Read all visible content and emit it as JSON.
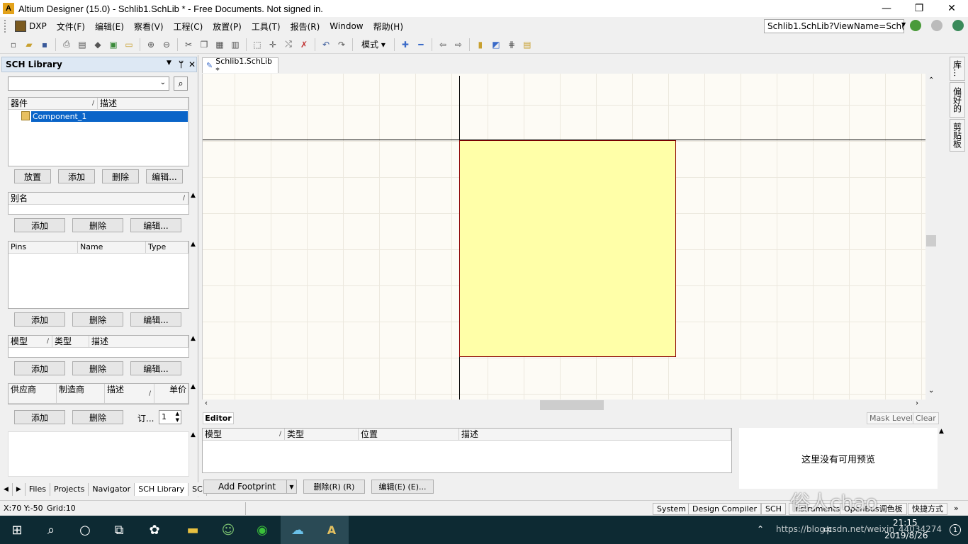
{
  "window": {
    "title": "Altium Designer (15.0) - Schlib1.SchLib * - Free Documents. Not signed in.",
    "controls": {
      "minimize": "—",
      "maximize": "❐",
      "close": "✕"
    }
  },
  "menubar": {
    "items": [
      "DXP",
      "文件(F)",
      "编辑(E)",
      "察看(V)",
      "工程(C)",
      "放置(P)",
      "工具(T)",
      "报告(R)",
      "Window",
      "帮助(H)"
    ],
    "address": "Schlib1.SchLib?ViewName=Sch("
  },
  "toolbar": {
    "mode_label": "模式"
  },
  "sch_library": {
    "title": "SCH Library",
    "components": {
      "columns": [
        "器件",
        "描述"
      ],
      "rows": [
        {
          "name": "Component_1",
          "selected": true
        }
      ],
      "buttons": [
        "放置",
        "添加",
        "删除",
        "编辑..."
      ]
    },
    "aliases": {
      "columns": [
        "别名"
      ],
      "buttons": [
        "添加",
        "删除",
        "编辑..."
      ]
    },
    "pins": {
      "columns": [
        "Pins",
        "Name",
        "Type"
      ],
      "buttons": [
        "添加",
        "删除",
        "编辑..."
      ]
    },
    "models": {
      "columns": [
        "模型",
        "类型",
        "描述"
      ],
      "buttons": [
        "添加",
        "删除",
        "编辑..."
      ]
    },
    "suppliers": {
      "columns": [
        "供应商",
        "制造商",
        "描述",
        "单价"
      ],
      "buttons": [
        "添加",
        "删除"
      ],
      "order_label": "订...",
      "order_qty": "1"
    },
    "bottom_tabs": [
      "Files",
      "Projects",
      "Navigator",
      "SCH Library",
      "SC"
    ]
  },
  "document": {
    "tab": "Schlib1.SchLib *"
  },
  "editor": {
    "tab": "Editor",
    "mask_level": "Mask Level",
    "clear": "Clear",
    "columns": [
      "模型",
      "类型",
      "位置",
      "描述"
    ],
    "add_footprint": "Add Footprint",
    "delete": "删除(R) (R)",
    "edit": "编辑(E) (E)...",
    "preview_text": "这里没有可用预览"
  },
  "right_tabs": [
    "库...",
    "偏好的",
    "剪贴板"
  ],
  "status": {
    "coords": "X:70 Y:-50",
    "grid": "Grid:10",
    "panels": [
      "System",
      "Design Compiler",
      "SCH",
      "Instruments",
      "OpenBus调色板",
      "快捷方式"
    ]
  },
  "taskbar": {
    "time": "21:15",
    "date": "2019/8/26",
    "ime": "中",
    "watermark_text": "俗人chao",
    "watermark_url": "https://blog.csdn.net/weixin_44034274"
  },
  "colors": {
    "component_fill": "#ffffa8",
    "component_border": "#8b0000",
    "selection": "#0a64c8",
    "taskbar": "#0d2a33"
  }
}
